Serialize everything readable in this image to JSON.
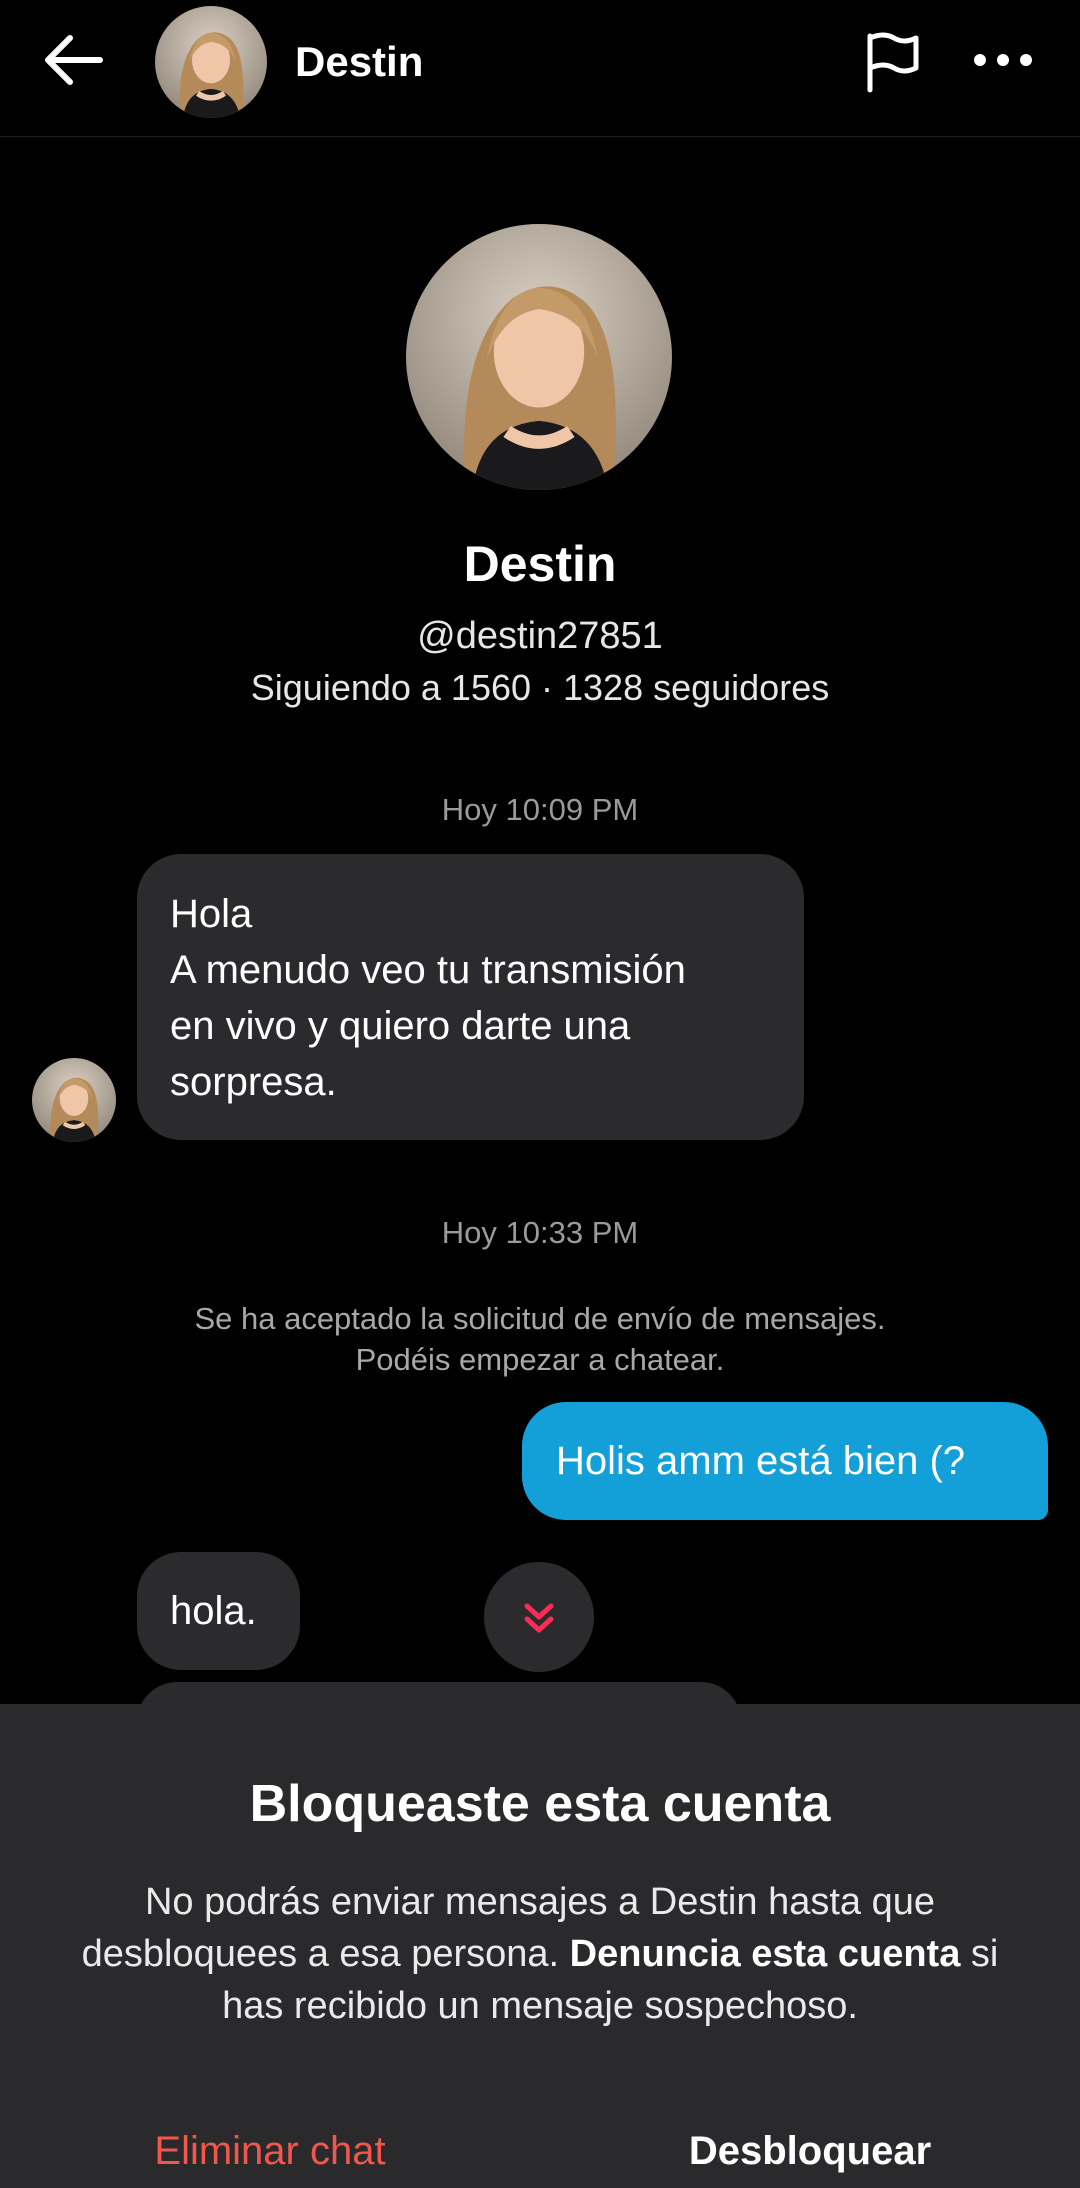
{
  "header": {
    "name": "Destin",
    "back_icon": "arrow-left-icon",
    "report_icon": "flag-icon",
    "more_icon": "more-horizontal-icon"
  },
  "profile": {
    "name": "Destin",
    "handle": "@destin27851",
    "stats": "Siguiendo a 1560 · 1328 seguidores"
  },
  "messages": {
    "timestamp_1": "Hoy 10:09 PM",
    "incoming_1": {
      "line1": "Hola",
      "line2": "A menudo veo tu transmisión",
      "line3": "en vivo y quiero darte una",
      "line4": "sorpresa."
    },
    "timestamp_2": "Hoy 10:33 PM",
    "system_line1": "Se ha aceptado la solicitud de envío de mensajes.",
    "system_line2": "Podéis empezar a chatear.",
    "outgoing_1": "Holis amm está bien (?",
    "incoming_2": "hola."
  },
  "sheet": {
    "title": "Bloqueaste esta cuenta",
    "body_part1": "No podrás enviar mensajes a Destin hasta que desbloquees a esa persona.",
    "body_bold": "Denuncia esta cuenta",
    "body_part2": "si has recibido un mensaje sospechoso.",
    "delete_label": "Eliminar chat",
    "unblock_label": "Desbloquear"
  },
  "colors": {
    "background": "#000000",
    "incoming_bubble": "#2b2b2d",
    "outgoing_bubble": "#139fd8",
    "danger": "#f0574d",
    "accent_pink": "#fe2c55"
  }
}
